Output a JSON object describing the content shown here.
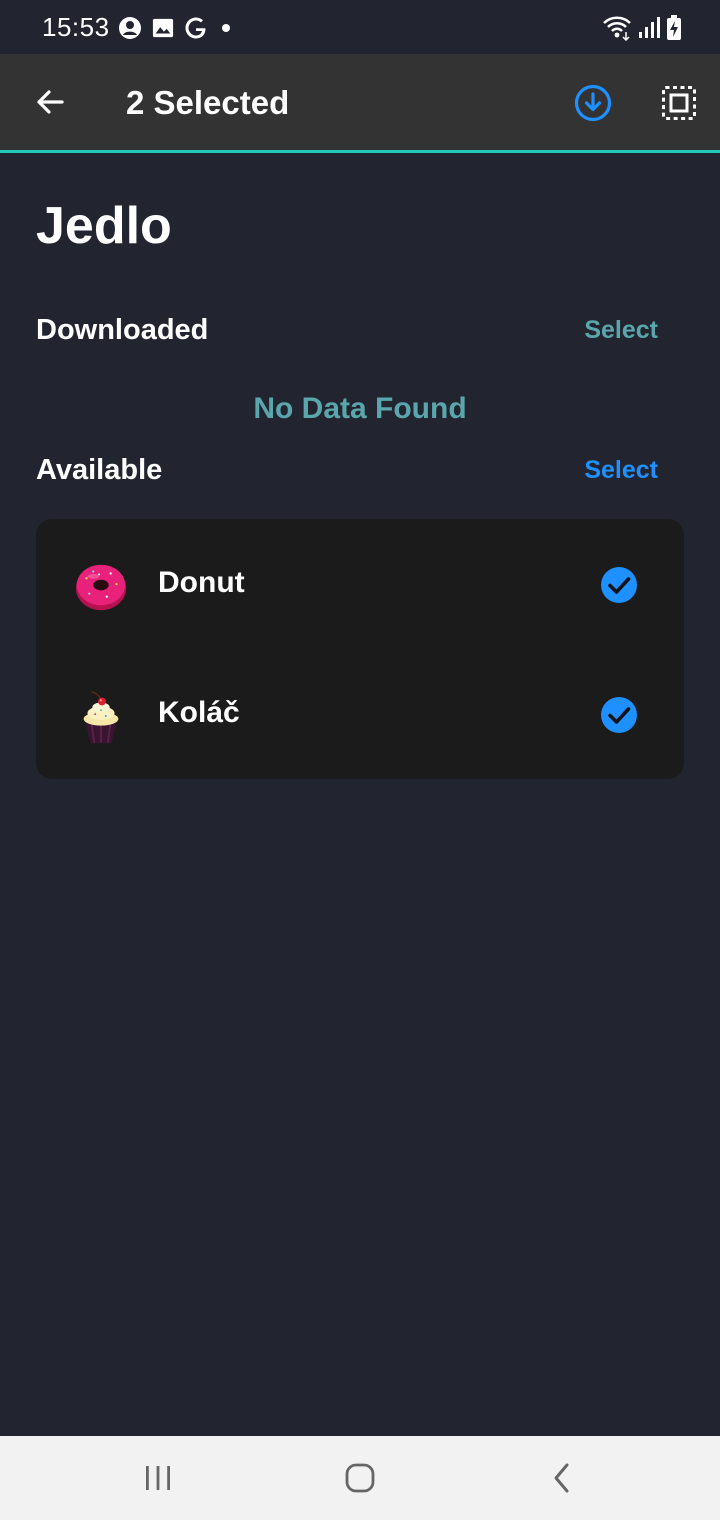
{
  "status_bar": {
    "time": "15:53",
    "left_icons": [
      "account-circle-icon",
      "image-icon",
      "google-icon",
      "dot-icon"
    ],
    "right_icons": [
      "wifi-icon",
      "signal-icon",
      "battery-charging-icon"
    ]
  },
  "app_bar": {
    "title": "2 Selected",
    "back_icon": "arrow-left-icon",
    "download_icon": "download-circle-icon",
    "select_all_icon": "select-all-icon"
  },
  "page": {
    "title": "Jedlo"
  },
  "downloaded": {
    "title": "Downloaded",
    "select_label": "Select",
    "empty_message": "No Data Found"
  },
  "available": {
    "title": "Available",
    "select_label": "Select",
    "items": [
      {
        "label": "Donut",
        "image": "donut-image",
        "checked": true
      },
      {
        "label": "Koláč",
        "image": "cupcake-image",
        "checked": true
      }
    ]
  },
  "nav_bar": {
    "icons": [
      "recent-apps-icon",
      "home-icon",
      "back-icon"
    ]
  },
  "colors": {
    "background": "#22252f",
    "app_bar": "#333333",
    "accent_line": "#20c9b8",
    "blue": "#1e90ff",
    "muted_teal": "#5aa6ac",
    "card": "#1b1b1b"
  }
}
